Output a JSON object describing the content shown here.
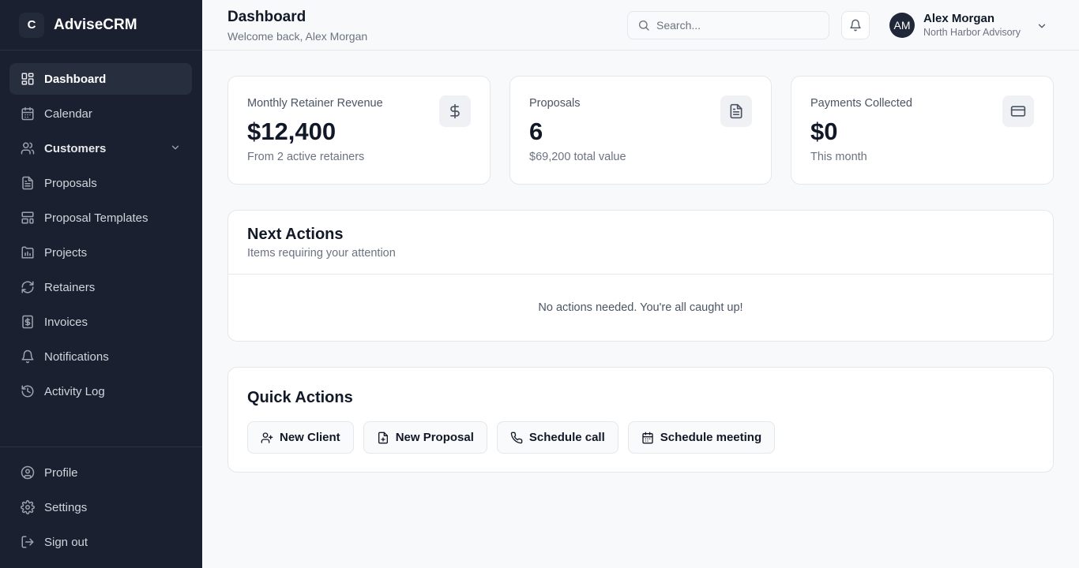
{
  "app": {
    "logo_letter": "C",
    "name": "AdviseCRM"
  },
  "sidebar": {
    "items": [
      {
        "label": "Dashboard",
        "icon": "dashboard-icon"
      },
      {
        "label": "Calendar",
        "icon": "calendar-icon"
      },
      {
        "label": "Customers",
        "icon": "users-icon"
      },
      {
        "label": "Proposals",
        "icon": "document-icon"
      },
      {
        "label": "Proposal Templates",
        "icon": "template-icon"
      },
      {
        "label": "Projects",
        "icon": "projects-icon"
      },
      {
        "label": "Retainers",
        "icon": "refresh-icon"
      },
      {
        "label": "Invoices",
        "icon": "invoice-icon"
      },
      {
        "label": "Notifications",
        "icon": "bell-icon"
      },
      {
        "label": "Activity Log",
        "icon": "history-icon"
      }
    ],
    "footer": [
      {
        "label": "Profile",
        "icon": "user-circle-icon"
      },
      {
        "label": "Settings",
        "icon": "gear-icon"
      },
      {
        "label": "Sign out",
        "icon": "sign-out-icon"
      }
    ]
  },
  "header": {
    "title": "Dashboard",
    "subtitle": "Welcome back, Alex Morgan",
    "search_placeholder": "Search...",
    "user": {
      "initials": "AM",
      "name": "Alex Morgan",
      "org": "North Harbor Advisory"
    }
  },
  "stats": [
    {
      "label": "Monthly Retainer Revenue",
      "value": "$12,400",
      "note": "From 2 active retainers",
      "icon": "dollar-icon"
    },
    {
      "label": "Proposals",
      "value": "6",
      "note": "$69,200 total value",
      "icon": "document-icon"
    },
    {
      "label": "Payments Collected",
      "value": "$0",
      "note": "This month",
      "icon": "credit-card-icon"
    }
  ],
  "next_actions": {
    "title": "Next Actions",
    "subtitle": "Items requiring your attention",
    "empty_text": "No actions needed. You're all caught up!"
  },
  "quick_actions": {
    "title": "Quick Actions",
    "buttons": [
      {
        "label": "New Client",
        "icon": "user-plus-icon"
      },
      {
        "label": "New Proposal",
        "icon": "file-plus-icon"
      },
      {
        "label": "Schedule call",
        "icon": "phone-icon"
      },
      {
        "label": "Schedule meeting",
        "icon": "calendar-icon"
      }
    ]
  },
  "colors": {
    "sidebar_bg": "#1a2030",
    "active_item_bg": "#272e3d",
    "page_bg": "#f8f9fb",
    "card_border": "#e5e7eb"
  }
}
